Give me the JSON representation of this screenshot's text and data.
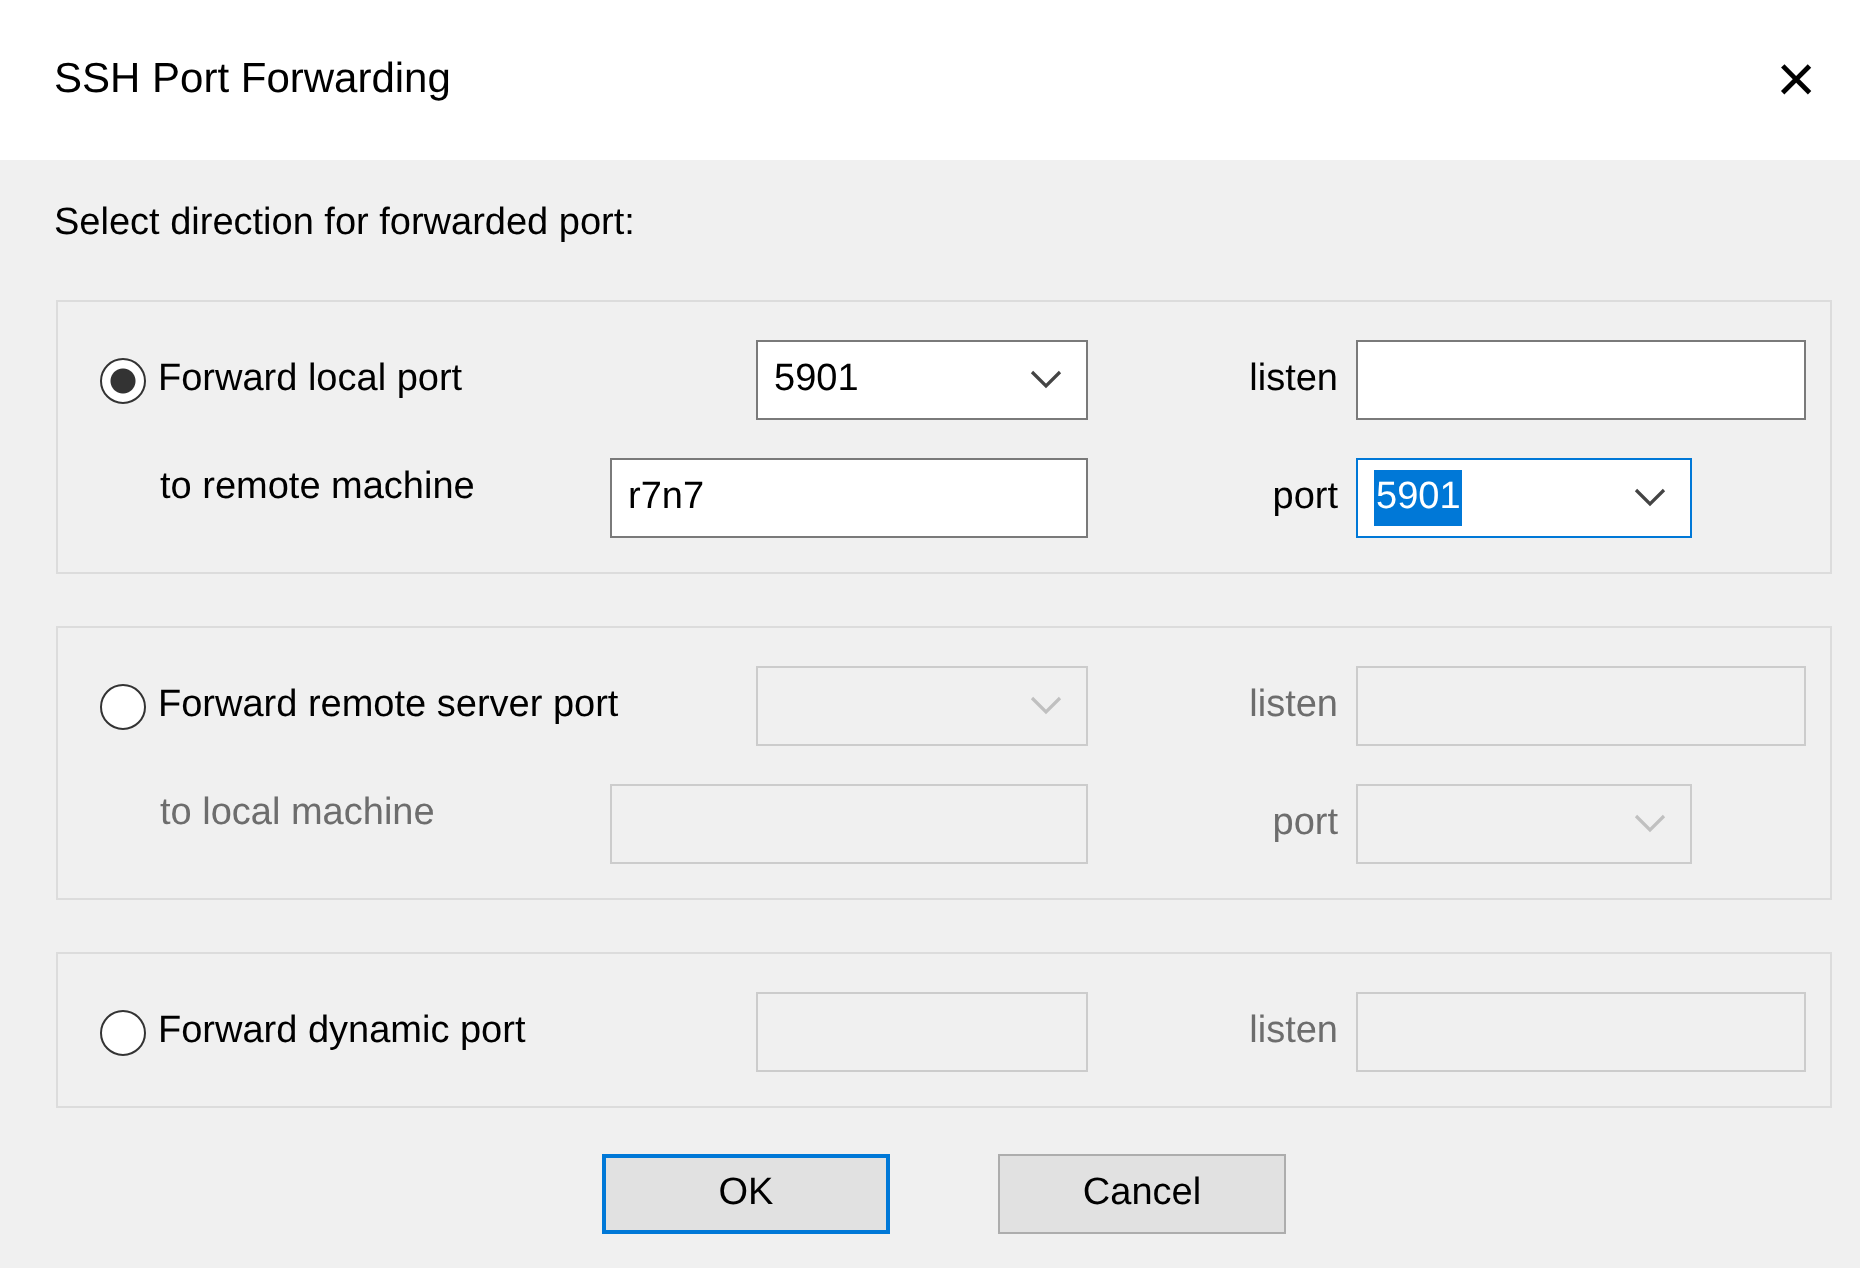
{
  "window": {
    "title": "SSH Port Forwarding",
    "close": "×"
  },
  "prompt": "Select direction for forwarded port:",
  "groups": [
    {
      "label": "Forward local port",
      "selected": true,
      "disabled": false,
      "rows": [
        {
          "field": {
            "kind": "combo",
            "value": "5901",
            "focused": false
          },
          "side_label": "listen",
          "side_field": {
            "kind": "text",
            "focused": false
          }
        },
        {
          "label": "to remote machine",
          "field": {
            "kind": "text",
            "value": "r7n7",
            "focused": false
          },
          "side_label": "port",
          "side_field": {
            "kind": "combo",
            "value": "5901",
            "focused": true
          }
        }
      ]
    },
    {
      "label": "Forward remote server port",
      "selected": false,
      "disabled": true,
      "rows": [
        {
          "field": {
            "kind": "combo",
            "focused": false
          },
          "side_label": "listen",
          "side_field": {
            "kind": "text",
            "focused": false
          }
        },
        {
          "label": "to local machine",
          "field": {
            "kind": "text",
            "focused": false
          },
          "side_label": "port",
          "side_field": {
            "kind": "combo",
            "focused": false
          }
        }
      ]
    },
    {
      "label": "Forward dynamic port",
      "selected": false,
      "disabled": true,
      "rows": [
        {
          "field": {
            "kind": "text",
            "focused": false
          },
          "side_label": "listen",
          "side_field": {
            "kind": "text",
            "focused": false
          }
        }
      ]
    }
  ],
  "buttons": [
    {
      "label": "OK",
      "default": true
    },
    {
      "label": "Cancel",
      "default": false
    }
  ]
}
